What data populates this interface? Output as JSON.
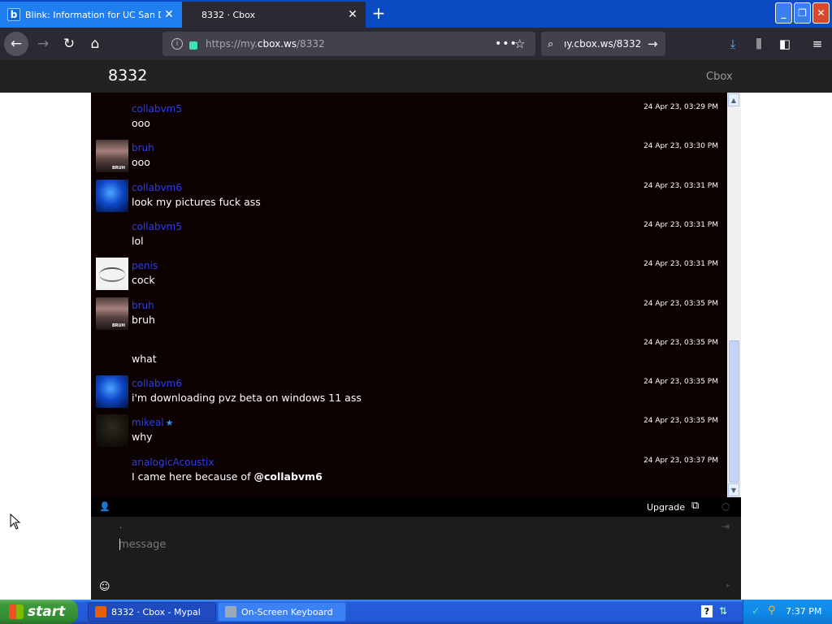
{
  "browser": {
    "tabs": [
      {
        "title": "Blink: Information for UC San Dieg",
        "favicon": "b",
        "active": false
      },
      {
        "title": "8332 · Cbox",
        "active": true
      }
    ],
    "new_tab_label": "+",
    "url_prefix": "https://my.",
    "url_domain": "cbox.ws",
    "url_path": "/8332",
    "search_text": "ıy.cbox.ws/8332"
  },
  "site": {
    "title": "8332",
    "brand": "Cbox"
  },
  "messages": [
    {
      "user": "collabvm5",
      "avatar": "none",
      "text": "ooo",
      "time": "24 Apr 23, 03:29 PM"
    },
    {
      "user": "bruh",
      "avatar": "bruh",
      "text": "ooo",
      "time": "24 Apr 23, 03:30 PM"
    },
    {
      "user": "collabvm6",
      "avatar": "blue",
      "text": "look my pictures fuck ass",
      "time": "24 Apr 23, 03:31 PM"
    },
    {
      "user": "collabvm5",
      "avatar": "none",
      "text": "lol",
      "time": "24 Apr 23, 03:31 PM"
    },
    {
      "user": "penis",
      "avatar": "scribble",
      "text": "cock",
      "time": "24 Apr 23, 03:31 PM"
    },
    {
      "user": "bruh",
      "avatar": "bruh",
      "text": "bruh",
      "time": "24 Apr 23, 03:35 PM"
    },
    {
      "user": "",
      "avatar": "none",
      "text": "what",
      "time": "24 Apr 23, 03:35 PM"
    },
    {
      "user": "collabvm6",
      "avatar": "blue",
      "text": "i'm downloading pvz beta on windows 11 ass",
      "time": "24 Apr 23, 03:35 PM"
    },
    {
      "user": "mikeal",
      "avatar": "dark",
      "text": "why",
      "time": "24 Apr 23, 03:35 PM",
      "badge": "★"
    },
    {
      "user": "analogicAcoustix",
      "avatar": "none",
      "text": "I came here because of ",
      "mention": "@collabvm6",
      "time": "24 Apr 23, 03:37 PM"
    }
  ],
  "chatbar": {
    "upgrade_label": "Upgrade"
  },
  "input": {
    "placeholder": "message",
    "dot": "."
  },
  "taskbar": {
    "start_label": "start",
    "items": [
      {
        "label": "8332 · Cbox - Mypal"
      },
      {
        "label": "On-Screen Keyboard"
      }
    ],
    "clock": "7:37 PM"
  },
  "colors": {
    "username": "#2d3ee8",
    "chat_bg": "#0d0000",
    "accent_star": "#3a8ff0"
  }
}
